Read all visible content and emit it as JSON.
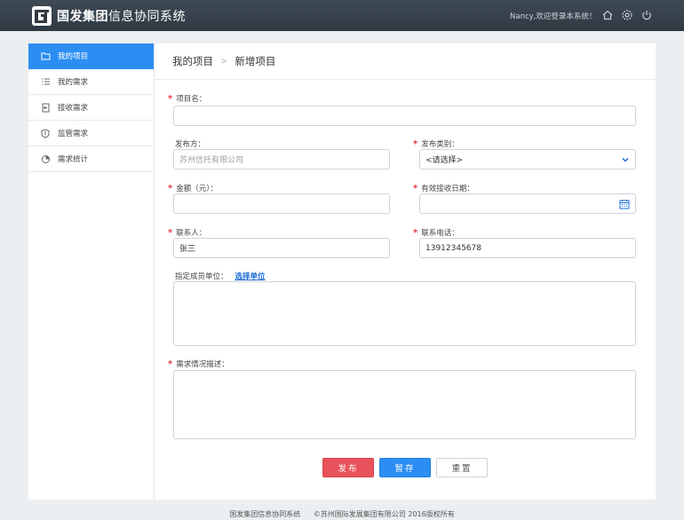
{
  "header": {
    "brand_bold": "国发集团",
    "brand_rest": "信息协同系统",
    "welcome": "Nancy,欢迎登录本系统！",
    "icons": [
      "home-icon",
      "gear-icon",
      "power-icon"
    ]
  },
  "sidebar": {
    "items": [
      {
        "label": "我的项目",
        "icon": "folder-icon",
        "active": true
      },
      {
        "label": "我的需求",
        "icon": "list-icon",
        "active": false
      },
      {
        "label": "接收需求",
        "icon": "receive-icon",
        "active": false
      },
      {
        "label": "监管需求",
        "icon": "shield-icon",
        "active": false
      },
      {
        "label": "需求统计",
        "icon": "pie-chart-icon",
        "active": false
      }
    ]
  },
  "breadcrumb": {
    "parent": "我的项目",
    "separator": ">",
    "current": "新增项目"
  },
  "form": {
    "required_mark": "*",
    "project_name": {
      "label": "项目名：",
      "value": ""
    },
    "publisher": {
      "label": "发布方：",
      "value": "苏州信托有限公司"
    },
    "category": {
      "label": "发布类别：",
      "value": "<请选择>"
    },
    "amount": {
      "label": "金额（元）：",
      "value": ""
    },
    "deadline": {
      "label": "有效接收日期：",
      "value": ""
    },
    "contact": {
      "label": "联系人：",
      "value": "张三"
    },
    "phone": {
      "label": "联系电话：",
      "value": "13912345678"
    },
    "members": {
      "label": "指定成员单位：",
      "link": "选择单位",
      "value": ""
    },
    "description": {
      "label": "需求情况描述：",
      "value": ""
    }
  },
  "buttons": {
    "publish": "发布",
    "save": "暂存",
    "reset": "重置"
  },
  "footer": {
    "system": "国发集团信息协同系统",
    "copyright": "©苏州国际发展集团有限公司 2016版权所有"
  },
  "colors": {
    "accent": "#2c8ef3",
    "danger": "#e8525a",
    "header": "#35404a",
    "required": "#e23b3b"
  }
}
